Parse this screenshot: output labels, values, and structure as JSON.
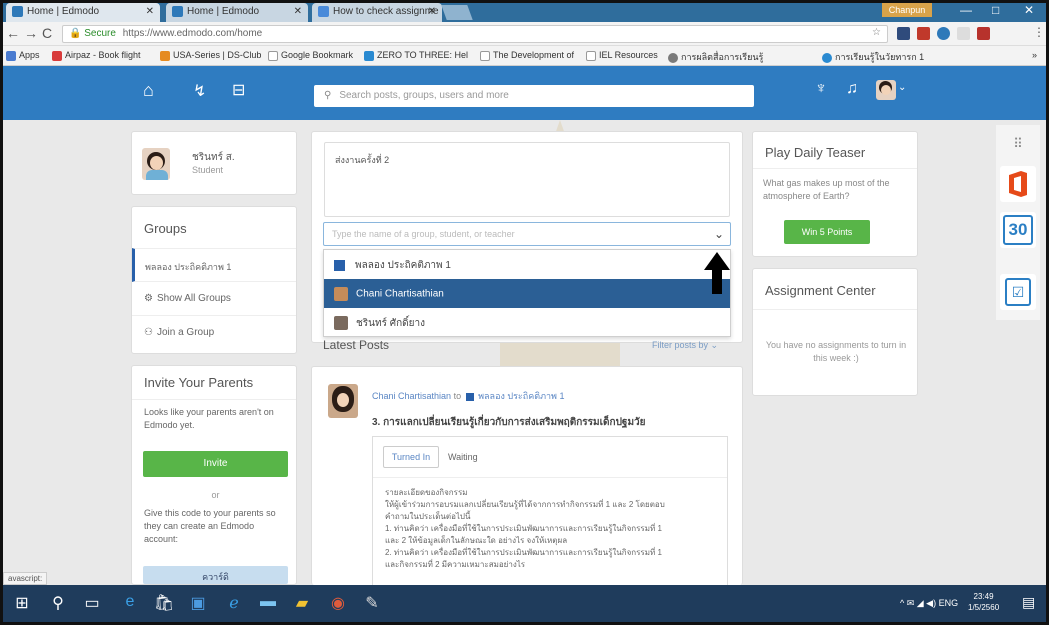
{
  "browser": {
    "tabs": [
      {
        "label": "Home | Edmodo"
      },
      {
        "label": "Home | Edmodo"
      },
      {
        "label": "How to check assignme"
      }
    ],
    "user_badge": "Chanpun",
    "url_secure": "Secure",
    "url": "https://www.edmodo.com/home",
    "bookmarks": [
      {
        "label": "Apps",
        "color": "#4a7bd0"
      },
      {
        "label": "Airpaz - Book flight",
        "color": "#d83b3b"
      },
      {
        "label": "USA-Series | DS-Club",
        "color": "#e58b22"
      },
      {
        "label": "Google Bookmark",
        "color": "#999999"
      },
      {
        "label": "ZERO TO THREE: Hel",
        "color": "#2a8ad1"
      },
      {
        "label": "The Development of",
        "color": "#999999"
      },
      {
        "label": "IEL Resources",
        "color": "#999999"
      },
      {
        "label": "การผลิตสื่อการเรียนรู้",
        "color": "#7a7a7a"
      },
      {
        "label": "การเรียนรู้ในวัยทารก 1",
        "color": "#2a8ad1"
      }
    ]
  },
  "edmodo": {
    "search_placeholder": "Search posts, groups, users and more",
    "profile": {
      "name": "ชรินทร์ ส.",
      "role": "Student"
    },
    "groups": {
      "title": "Groups",
      "items": [
        "พลลอง ประถิคติภาพ 1"
      ],
      "show_all": "Show All Groups",
      "join": "Join a Group"
    },
    "invite": {
      "title": "Invite Your Parents",
      "text": "Looks like your parents aren't on Edmodo yet.",
      "button": "Invite",
      "or": "or",
      "code_text": "Give this code to your parents so they can create an Edmodo account:",
      "code_label": "ควาร์ดิ"
    },
    "composer": {
      "post_text": "ส่งงานครั้งที่ 2",
      "recipient_placeholder": "Type the name of a group, student, or teacher",
      "options": [
        {
          "label": "พลลอง ประถิคติภาพ 1",
          "selected": false
        },
        {
          "label": "Chani Chartisathian",
          "selected": true
        },
        {
          "label": "ชรินทร์ ศักดิ์ยาง",
          "selected": false
        }
      ]
    },
    "feed": {
      "title": "Latest Posts",
      "filter": "Filter posts by",
      "post": {
        "author": "Chani Chartisathian",
        "to": "to",
        "group": "พลลอง ประถิคติภาพ 1",
        "title": "3. การแลกเปลี่ยนเรียนรู้เกี่ยวกับการส่งเสริมพฤติกรรมเด็กปฐมวัย",
        "tabs": [
          "Turned In",
          "Waiting"
        ],
        "body_lines": [
          "รายละเอียดของกิจกรรม",
          "ให้ผู้เข้าร่วมการอบรมแลกเปลี่ยนเรียนรู้ที่ได้จากการทำกิจกรรมที่ 1 และ 2 โดยตอบ",
          "คำถามในประเด็นต่อไปนี้",
          "1. ท่านคิดว่า เครื่องมือที่ใช้ในการประเมินพัฒนาการและการเรียนรู้ในกิจกรรมที่ 1",
          "และ 2 ให้ข้อมูลเด็กในลักษณะใด อย่างไร จงให้เหตุผล",
          "2. ท่านคิดว่า เครื่องมือที่ใช้ในการประเมินพัฒนาการและการเรียนรู้ในกิจกรรมที่ 1",
          "และกิจกรรมที่ 2 มีความเหมาะสมอย่างไร"
        ]
      }
    },
    "teaser": {
      "title": "Play Daily Teaser",
      "question": "What gas makes up most of the atmosphere of Earth?",
      "button": "Win 5 Points"
    },
    "assignments": {
      "title": "Assignment Center",
      "empty": "You have no assignments to turn in this week :)"
    },
    "rail": {
      "calendar_day": "30"
    }
  },
  "status_hint": "avascript:",
  "taskbar": {
    "time": "23:49",
    "date": "1/5/2560",
    "lang": "ENG"
  }
}
